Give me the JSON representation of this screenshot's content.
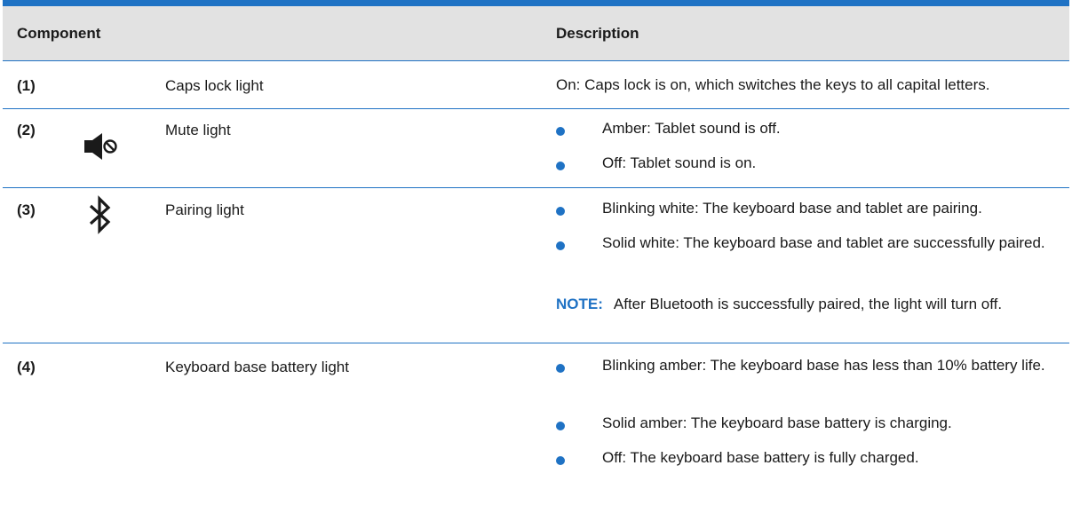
{
  "header": {
    "component": "Component",
    "description": "Description"
  },
  "rows": [
    {
      "num": "(1)",
      "label": "Caps lock light",
      "desc": "On: Caps lock is on, which switches the keys to all capital letters."
    },
    {
      "num": "(2)",
      "icon": "mute-icon",
      "label": "Mute light",
      "bullets": [
        "Amber: Tablet sound is off.",
        "Off: Tablet sound is on."
      ]
    },
    {
      "num": "(3)",
      "icon": "bluetooth-icon",
      "label": "Pairing light",
      "bullets": [
        "Blinking white: The keyboard base and tablet are pairing.",
        "Solid white: The keyboard base and tablet are successfully paired."
      ],
      "note_label": "NOTE:",
      "note_text": "After Bluetooth is successfully paired, the light will turn off."
    },
    {
      "num": "(4)",
      "label": "Keyboard base battery light",
      "bullets": [
        "Blinking amber: The keyboard base has less than 10% battery life.",
        "Solid amber: The keyboard base battery is charging.",
        "Off: The keyboard base battery is fully charged."
      ]
    }
  ],
  "colors": {
    "accent": "#1f72c4",
    "header_bg": "#e2e2e2"
  }
}
